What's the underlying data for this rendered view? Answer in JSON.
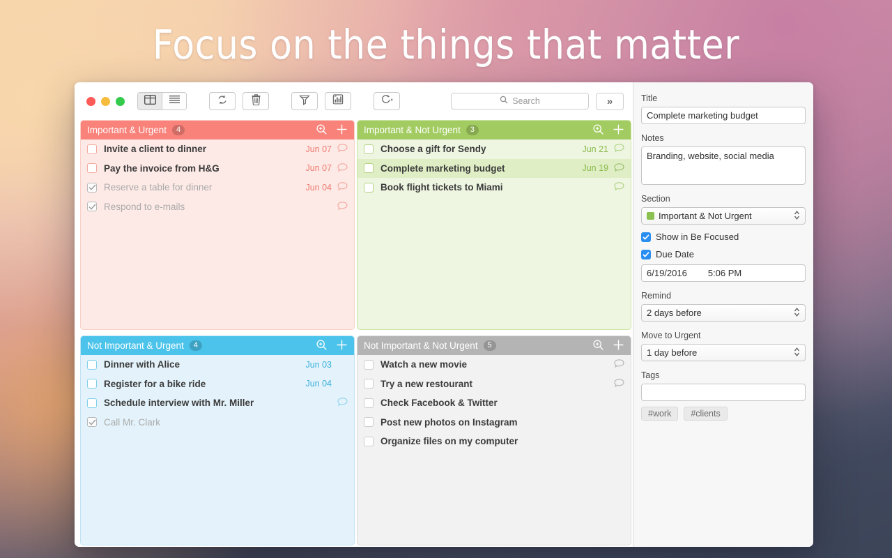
{
  "headline": "Focus on the things that matter",
  "window": {
    "traffic_lights": [
      "close",
      "minimize",
      "zoom"
    ],
    "toolbar": {
      "view_grid_label": "grid-view",
      "view_list_label": "list-view",
      "sync_label": "sync",
      "delete_label": "delete",
      "filter_label": "filter",
      "stats_label": "statistics",
      "timer_label": "timer",
      "search_placeholder": "Search",
      "search_value": "",
      "more_label": "»"
    }
  },
  "quadrants": [
    {
      "id": "important-urgent",
      "title": "Important & Urgent",
      "count": "4",
      "color": "#f9827a",
      "tasks": [
        {
          "label": "Invite a client to dinner",
          "due": "Jun 07",
          "done": false,
          "has_note": true,
          "selected": false
        },
        {
          "label": "Pay the invoice from H&G",
          "due": "Jun 07",
          "done": false,
          "has_note": true,
          "selected": false
        },
        {
          "label": "Reserve a table for dinner",
          "due": "Jun 04",
          "done": true,
          "has_note": true,
          "selected": false
        },
        {
          "label": "Respond to e-mails",
          "due": "",
          "done": true,
          "has_note": true,
          "selected": false
        }
      ]
    },
    {
      "id": "important-not-urgent",
      "title": "Important & Not Urgent",
      "count": "3",
      "color": "#a2cc61",
      "tasks": [
        {
          "label": "Choose a gift for Sendy",
          "due": "Jun 21",
          "done": false,
          "has_note": true,
          "selected": false
        },
        {
          "label": "Complete marketing budget",
          "due": "Jun 19",
          "done": false,
          "has_note": true,
          "selected": true
        },
        {
          "label": "Book flight tickets to Miami",
          "due": "",
          "done": false,
          "has_note": true,
          "selected": false
        }
      ]
    },
    {
      "id": "not-important-urgent",
      "title": "Not Important & Urgent",
      "count": "4",
      "color": "#4bc3ea",
      "tasks": [
        {
          "label": "Dinner with Alice",
          "due": "Jun 03",
          "done": false,
          "has_note": false,
          "selected": false
        },
        {
          "label": "Register for a bike ride",
          "due": "Jun 04",
          "done": false,
          "has_note": false,
          "selected": false
        },
        {
          "label": "Schedule interview with Mr. Miller",
          "due": "",
          "done": false,
          "has_note": true,
          "selected": false
        },
        {
          "label": "Call Mr. Clark",
          "due": "",
          "done": true,
          "has_note": false,
          "selected": false
        }
      ]
    },
    {
      "id": "not-important-not-urgent",
      "title": "Not Important & Not Urgent",
      "count": "5",
      "color": "#b4b4b4",
      "tasks": [
        {
          "label": "Watch a new movie",
          "due": "",
          "done": false,
          "has_note": true,
          "selected": false
        },
        {
          "label": "Try a new restourant",
          "due": "",
          "done": false,
          "has_note": true,
          "selected": false
        },
        {
          "label": "Check Facebook & Twitter",
          "due": "",
          "done": false,
          "has_note": false,
          "selected": false
        },
        {
          "label": "Post new photos on Instagram",
          "due": "",
          "done": false,
          "has_note": false,
          "selected": false
        },
        {
          "label": "Organize files on my computer",
          "due": "",
          "done": false,
          "has_note": false,
          "selected": false
        }
      ]
    }
  ],
  "inspector": {
    "title_label": "Title",
    "title_value": "Complete marketing budget",
    "notes_label": "Notes",
    "notes_value": "Branding, website, social media",
    "section_label": "Section",
    "section_value": "Important & Not Urgent",
    "section_color": "#8cc152",
    "show_in_be_focused_label": "Show in Be Focused",
    "show_in_be_focused_checked": true,
    "due_date_label": "Due Date",
    "due_date_checked": true,
    "due_date_value": "6/19/2016",
    "due_time_value": "5:06 PM",
    "remind_label": "Remind",
    "remind_value": "2 days before",
    "move_to_urgent_label": "Move to Urgent",
    "move_to_urgent_value": "1 day before",
    "tags_label": "Tags",
    "tags_value": "",
    "tags": [
      "#work",
      "#clients"
    ]
  }
}
